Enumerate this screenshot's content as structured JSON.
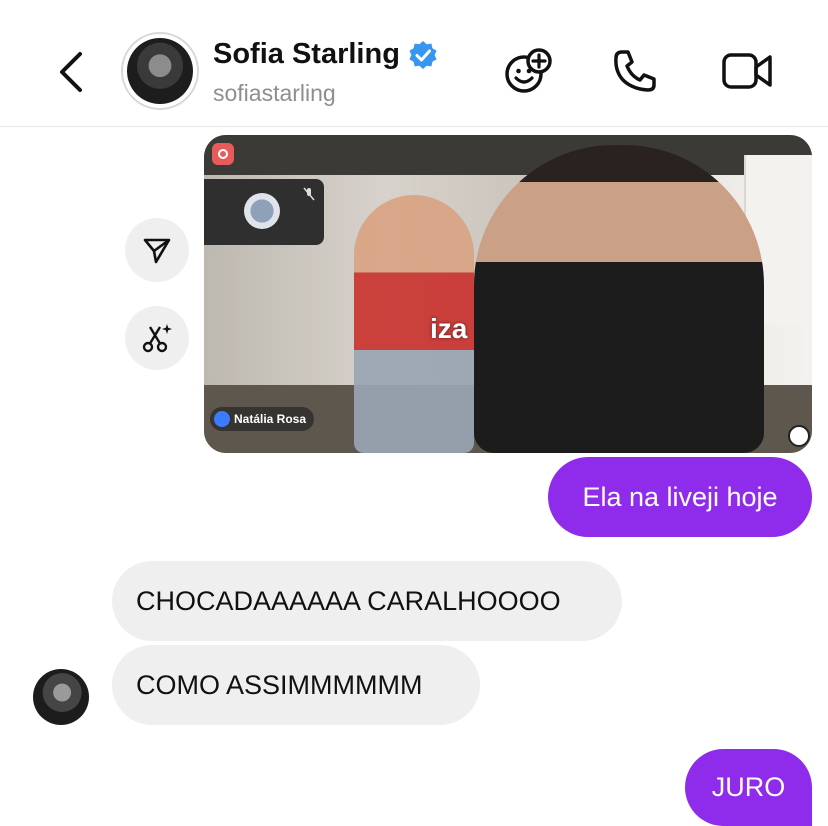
{
  "header": {
    "contact_name": "Sofia Starling",
    "contact_handle": "sofiastarling",
    "verified": true,
    "icons": [
      "back-arrow-icon",
      "add-emoji-icon",
      "phone-icon",
      "video-camera-icon"
    ]
  },
  "shared_media": {
    "overlay_label": "iza",
    "stream_name": "Natália Rosa"
  },
  "messages": [
    {
      "direction": "out",
      "text": "Ela na liveji hoje"
    },
    {
      "direction": "in",
      "text": "CHOCADAAAAAA CARALHOOOO"
    },
    {
      "direction": "in",
      "text": "COMO ASSIMMMMMM"
    },
    {
      "direction": "out",
      "text": "JURO"
    }
  ],
  "colors": {
    "outgoing_bubble": "#8f2bea",
    "incoming_bubble": "#efeff0",
    "verified_badge": "#3797f0"
  }
}
